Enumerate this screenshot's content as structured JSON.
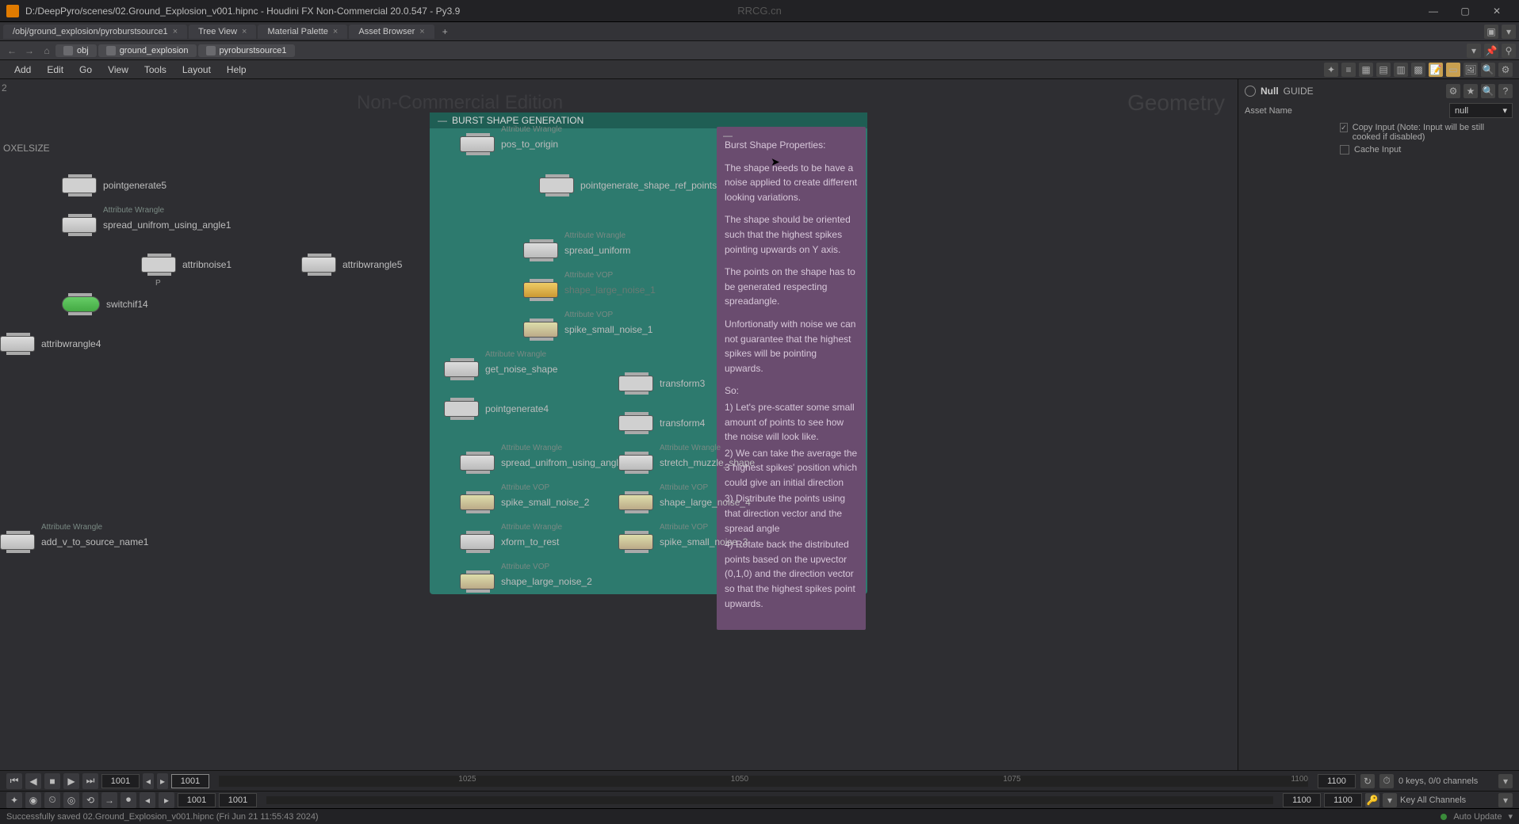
{
  "window": {
    "title": "D:/DeepPyro/scenes/02.Ground_Explosion_v001.hipnc - Houdini FX Non-Commercial 20.0.547 - Py3.9",
    "watermark": "RRCG.cn"
  },
  "tabs": [
    {
      "label": "/obj/ground_explosion/pyroburstsource1"
    },
    {
      "label": "Tree View"
    },
    {
      "label": "Material Palette"
    },
    {
      "label": "Asset Browser"
    }
  ],
  "path": {
    "segs": [
      "obj",
      "ground_explosion",
      "pyroburstsource1"
    ]
  },
  "menu": [
    "Add",
    "Edit",
    "Go",
    "View",
    "Tools",
    "Layout",
    "Help"
  ],
  "network": {
    "voxelsize": "OXELSIZE",
    "edition": "Non-Commercial Edition",
    "pane_type": "Geometry",
    "netbox_title": "BURST SHAPE GENERATION",
    "sticky": {
      "p1": "Burst Shape Properties:",
      "p2": "The shape needs to be have a noise applied to create different looking variations.",
      "p3": "The shape should be oriented such that the highest spikes pointing upwards on Y axis.",
      "p4": "The points on the shape has to be generated respecting spreadangle.",
      "p5": "Unfortionatly with noise we can not guarantee that the highest spikes will be pointing upwards.",
      "p6": "So:",
      "p7": "1) Let's pre-scatter some small amount of points to see how the noise will look like.",
      "p8": "2) We can take the average the 3 highest spikes' position which could give an initial direction",
      "p9": "3) Distribute the points using that direction vector and the spread angle",
      "p10": "4) Rotate back the distributed points based on the upvector (0,1,0) and the direction vector so that the highest spikes point upwards."
    },
    "nodes": {
      "pos_to_origin": {
        "tag": "Attribute Wrangle",
        "label": "pos_to_origin"
      },
      "pointgenerate_shape_ref_points": {
        "tag": "",
        "label": "pointgenerate_shape_ref_points"
      },
      "spread_uniform": {
        "tag": "Attribute Wrangle",
        "label": "spread_uniform"
      },
      "shape_large_noise_1": {
        "tag": "Attribute VOP",
        "label": "shape_large_noise_1"
      },
      "spike_small_noise_1": {
        "tag": "Attribute VOP",
        "label": "spike_small_noise_1"
      },
      "get_noise_shape": {
        "tag": "Attribute Wrangle",
        "label": "get_noise_shape"
      },
      "pointgenerate4": {
        "tag": "",
        "label": "pointgenerate4"
      },
      "transform3": {
        "tag": "",
        "label": "transform3"
      },
      "transform4": {
        "tag": "",
        "label": "transform4"
      },
      "spread_unifrom_using_angle": {
        "tag": "Attribute Wrangle",
        "label": "spread_unifrom_using_angle"
      },
      "stretch_muzzle_shape": {
        "tag": "Attribute Wrangle",
        "label": "stretch_muzzle_shape"
      },
      "spike_small_noise_2": {
        "tag": "Attribute VOP",
        "label": "spike_small_noise_2"
      },
      "shape_large_noise_4": {
        "tag": "Attribute VOP",
        "label": "shape_large_noise_4"
      },
      "xform_to_rest": {
        "tag": "Attribute Wrangle",
        "label": "xform_to_rest"
      },
      "spike_small_noise_3": {
        "tag": "Attribute VOP",
        "label": "spike_small_noise_3"
      },
      "shape_large_noise_2": {
        "tag": "Attribute VOP",
        "label": "shape_large_noise_2"
      },
      "pointgenerate5": {
        "tag": "",
        "label": "pointgenerate5"
      },
      "spread_unifrom_using_angle1": {
        "tag": "Attribute Wrangle",
        "label": "spread_unifrom_using_angle1"
      },
      "attribnoise1": {
        "tag": "",
        "label": "attribnoise1",
        "flag": "P"
      },
      "attribwrangle5": {
        "tag": "",
        "label": "attribwrangle5"
      },
      "switchif14": {
        "tag": "",
        "label": "switchif14"
      },
      "attribwrangle4": {
        "tag": "",
        "label": "attribwrangle4"
      },
      "add_v_to_source_name1": {
        "tag": "Attribute Wrangle",
        "label": "add_v_to_source_name1"
      }
    }
  },
  "rightpanel": {
    "type": "Null",
    "name": "GUIDE",
    "asset_label": "Asset Name",
    "asset_value": "null",
    "copy_input": "Copy Input (Note: Input will be still cooked if disabled)",
    "cache_input": "Cache Input"
  },
  "timeline": {
    "current": "1001",
    "frame_field": "1001",
    "ticks": [
      "1025",
      "1050",
      "1075",
      "1100"
    ],
    "end": "1100",
    "keys_label": "0 keys, 0/0 channels",
    "key_all": "Key All Channels",
    "rstart": "1001",
    "rend": "1001",
    "gend1": "1100",
    "gend2": "1100"
  },
  "status": {
    "msg": "Successfully saved 02.Ground_Explosion_v001.hipnc (Fri Jun 21 11:55:43 2024)",
    "auto_update": "Auto Update"
  }
}
